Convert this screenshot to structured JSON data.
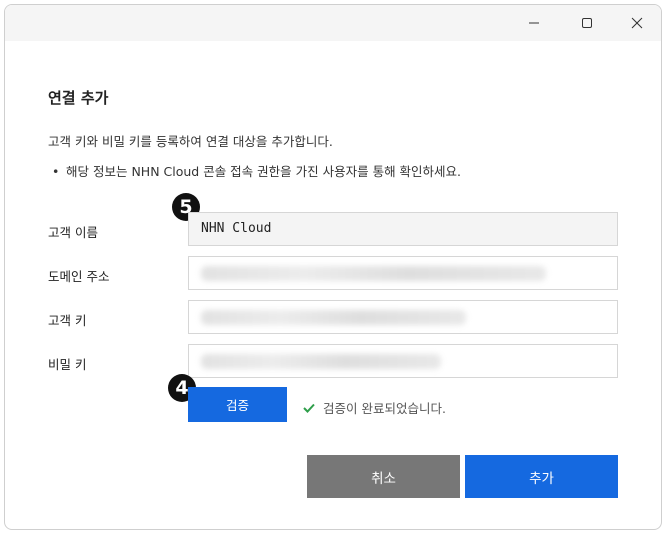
{
  "dialog": {
    "title": "연결 추가",
    "description": "고객 키와 비밀 키를 등록하여 연결 대상을 추가합니다.",
    "note_bullet": "•",
    "note": "해당 정보는 NHN Cloud 콘솔 접속 권한을 가진 사용자를 통해 확인하세요."
  },
  "fields": {
    "customer_name": {
      "label": "고객 이름",
      "value": "NHN Cloud"
    },
    "domain": {
      "label": "도메인 주소"
    },
    "customer_key": {
      "label": "고객 키"
    },
    "secret_key": {
      "label": "비밀 키"
    }
  },
  "markers": {
    "m5": "5",
    "m4": "4"
  },
  "verify": {
    "button_label": "검증",
    "status": "검증이 완료되었습니다."
  },
  "actions": {
    "cancel_label": "취소",
    "add_label": "추가"
  },
  "colors": {
    "primary": "#1569e0",
    "cancel": "#777777",
    "success": "#2e9e4a"
  }
}
